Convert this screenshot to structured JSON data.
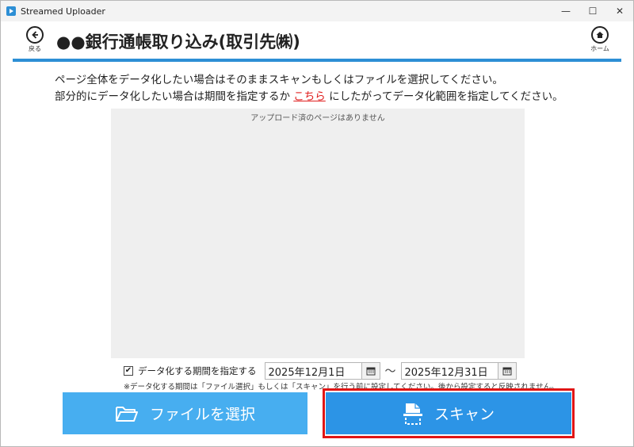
{
  "window": {
    "title": "Streamed Uploader",
    "controls": {
      "minimize": "—",
      "maximize": "☐",
      "close": "✕"
    }
  },
  "header": {
    "back_label": "戻る",
    "title": "●●銀行通帳取り込み(取引先㈱)",
    "home_label": "ホーム"
  },
  "instructions": {
    "line1": "ページ全体をデータ化したい場合はそのままスキャンもしくはファイルを選択してください。",
    "line2_before": "部分的にデータ化したい場合は期間を指定するか",
    "line2_link": "こちら",
    "line2_after": "にしたがってデータ化範囲を指定してください。"
  },
  "preview": {
    "empty_text": "アップロード済のページはありません"
  },
  "date_range": {
    "checked": true,
    "label": "データ化する期間を指定する",
    "start_date": "2025年12月1日",
    "separator": "～",
    "end_date": "2025年12月31日",
    "note": "※データ化する期間は「ファイル選択」もしくは「スキャン」を行う前に設定してください。後から設定すると反映されません。"
  },
  "actions": {
    "file_button": "ファイルを選択",
    "scan_button": "スキャン"
  },
  "icons": [
    "back-arrow-icon",
    "home-icon",
    "calendar-icon",
    "folder-icon",
    "scanner-icon",
    "checkmark-icon"
  ],
  "colors": {
    "accent": "#2d8fd5",
    "file_button": "#47aef0",
    "scan_button": "#2c94e6",
    "highlight_frame": "#e01515",
    "link": "#e02020"
  }
}
